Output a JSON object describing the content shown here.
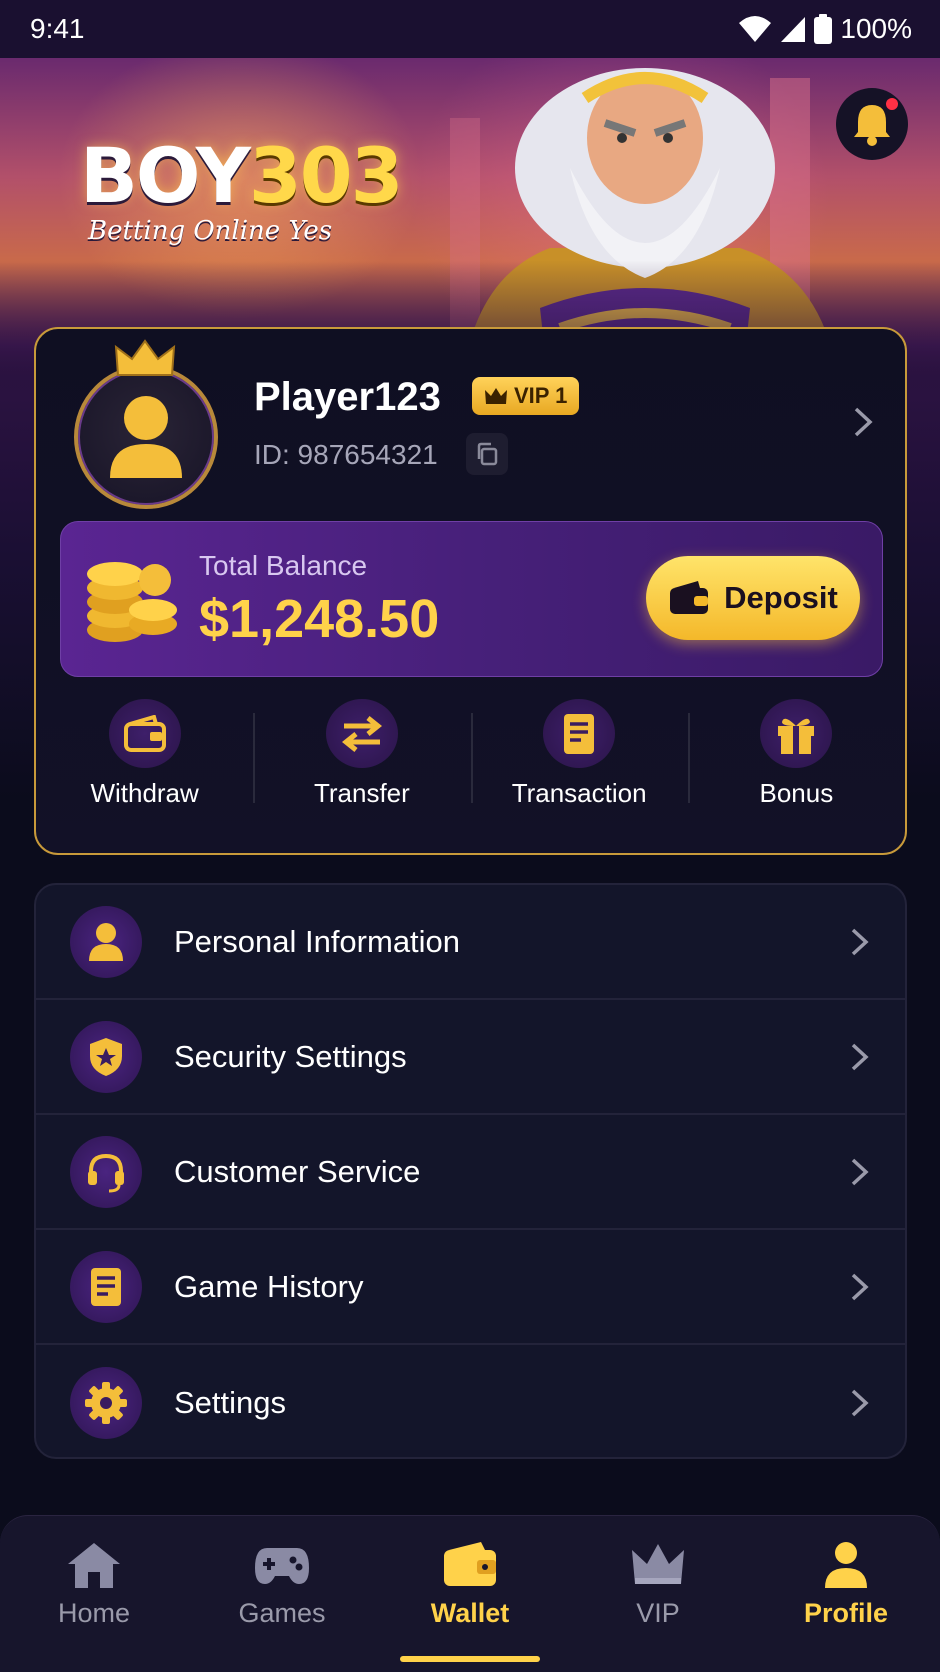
{
  "status_bar": {
    "time": "9:41",
    "battery": "100%"
  },
  "banner": {
    "logo_main_a": "BOY",
    "logo_main_b": "303",
    "logo_sub": "Betting Online Yes"
  },
  "profile": {
    "username": "Player123",
    "vip_label": "VIP 1",
    "player_id": "ID: 987654321"
  },
  "balance": {
    "label": "Total Balance",
    "value": "$1,248.50",
    "deposit_label": "Deposit"
  },
  "quick_actions": [
    {
      "label": "Withdraw",
      "icon": "wallet-icon"
    },
    {
      "label": "Transfer",
      "icon": "transfer-icon"
    },
    {
      "label": "Transaction",
      "icon": "receipt-icon"
    },
    {
      "label": "Bonus",
      "icon": "gift-icon"
    }
  ],
  "menu": [
    {
      "label": "Personal Information",
      "icon": "user-icon"
    },
    {
      "label": "Security Settings",
      "icon": "shield-icon"
    },
    {
      "label": "Customer Service",
      "icon": "headset-icon"
    },
    {
      "label": "Game History",
      "icon": "document-icon"
    },
    {
      "label": "Settings",
      "icon": "gear-icon"
    }
  ],
  "bottom_nav": [
    {
      "label": "Home",
      "icon": "home-icon"
    },
    {
      "label": "Games",
      "icon": "gamepad-icon"
    },
    {
      "label": "Wallet",
      "icon": "wallet-icon"
    },
    {
      "label": "VIP",
      "icon": "crown-icon"
    },
    {
      "label": "Profile",
      "icon": "user-icon"
    }
  ],
  "colors": {
    "accent": "#ffd24a",
    "purple": "#5a2592",
    "background": "#0b0c1c",
    "border_gold": "#c89a3a"
  }
}
